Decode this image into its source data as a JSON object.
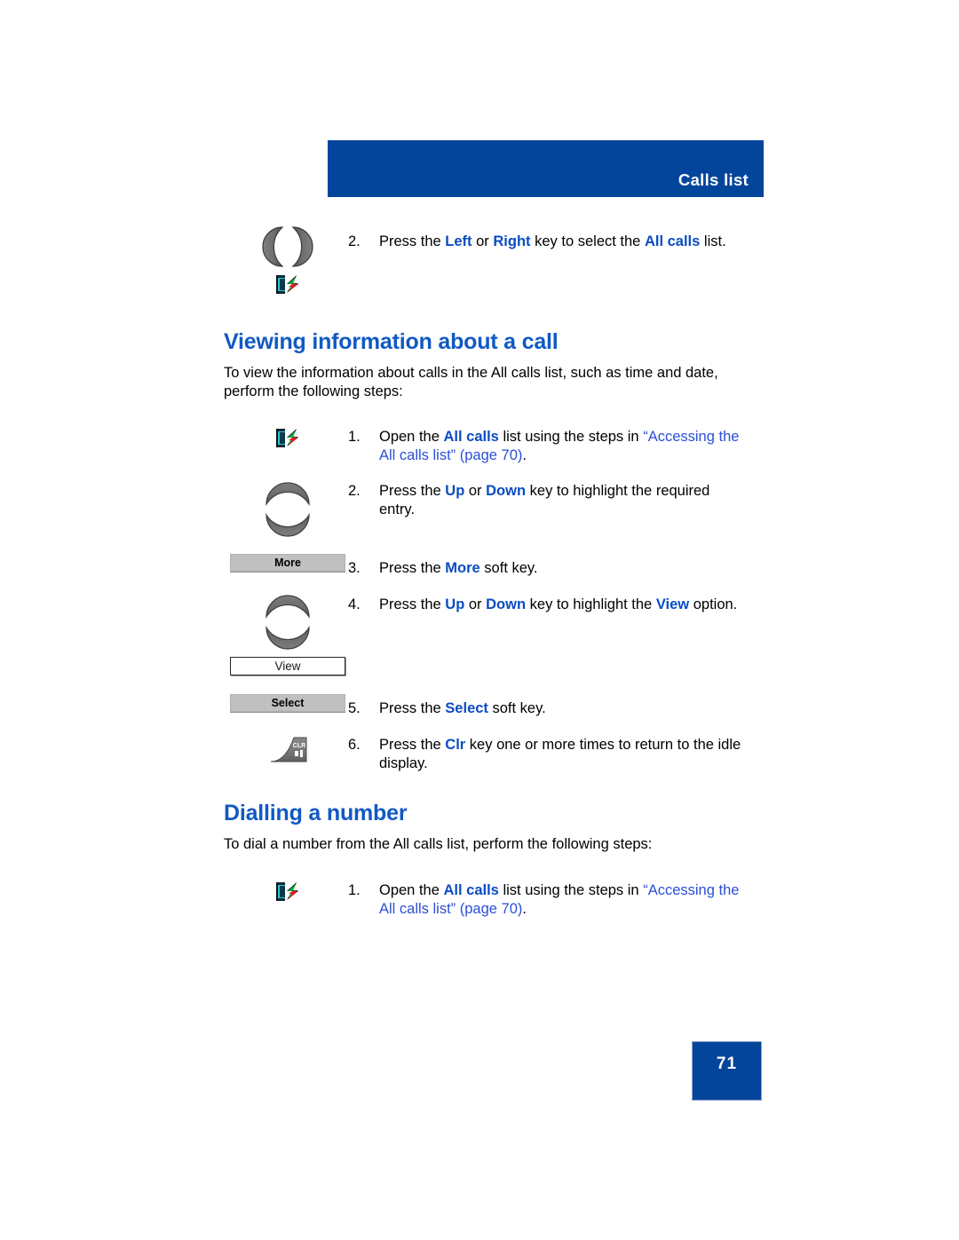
{
  "header": {
    "title": "Calls list",
    "banner_color": "#04459c"
  },
  "colors": {
    "heading_blue": "#1059c4",
    "keyword_blue": "#0b4cc4",
    "link_blue": "#2a4fd8",
    "softkey_gray": "#c0c0c0"
  },
  "top_step": {
    "number": "2.",
    "text_1": "Press the ",
    "kw_1": "Left",
    "text_2": " or ",
    "kw_2": "Right",
    "text_3": " key to select the ",
    "kw_3": "All calls",
    "text_4": " list.",
    "icon_left_right": "navigation-left-right-key-icon",
    "icon_calls": "calls-list-key-icon"
  },
  "section_viewing": {
    "heading": "Viewing information about a call",
    "intro": "To view the information about calls in the All calls list, such as time and date, perform the following steps:",
    "steps": [
      {
        "number": "1.",
        "icon": "calls-list-key-icon",
        "text_1": "Open the ",
        "kw_1": "All calls",
        "text_2": " list using the steps in ",
        "link": "“Accessing the All calls list” (page 70)",
        "text_3": "."
      },
      {
        "number": "2.",
        "icon": "navigation-up-down-key-icon",
        "text_1": "Press the ",
        "kw_1": "Up",
        "text_2": " or ",
        "kw_2": "Down",
        "text_3": " key to highlight the required entry."
      },
      {
        "number": "3.",
        "icon": "softkey-more",
        "text_1": "Press the ",
        "kw_1": "More",
        "text_2": " soft key."
      },
      {
        "number": "4.",
        "icon": "navigation-up-down-key-icon",
        "text_1": "Press the ",
        "kw_1": "Up",
        "text_2": " or ",
        "kw_2": "Down",
        "text_3": " key to highlight the ",
        "kw_3": "View",
        "text_4": " option."
      },
      {
        "number": "5.",
        "icon": "softkey-select",
        "text_1": "Press the ",
        "kw_1": "Select",
        "text_2": " soft key."
      },
      {
        "number": "6.",
        "icon": "clr-key-icon",
        "text_1": "Press the ",
        "kw_1": "Clr",
        "text_2": " key one or more times to return to the idle display."
      }
    ],
    "softkeys": {
      "more": "More",
      "view": "View",
      "select": "Select"
    }
  },
  "section_dialling": {
    "heading": "Dialling a number",
    "intro": "To dial a number from the All calls list, perform the following steps:",
    "steps": [
      {
        "number": "1.",
        "icon": "calls-list-key-icon",
        "text_1": "Open the ",
        "kw_1": "All calls",
        "text_2": " list using the steps in ",
        "link": "“Accessing the All calls list” (page 70)",
        "text_3": "."
      }
    ]
  },
  "footer": {
    "page_number": "71"
  }
}
